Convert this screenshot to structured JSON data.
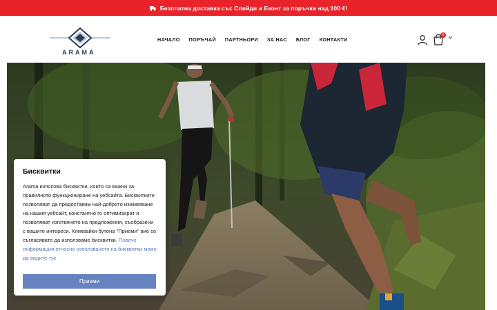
{
  "promo": {
    "text": "Безплатна доставка със Спийди и Еконт за поръчки над 100 €!",
    "icon": "truck-icon",
    "background": "#e8232a"
  },
  "header": {
    "logo_text": "ARAMA",
    "nav": [
      "НАЧАЛО",
      "ПОРЪЧАЙ",
      "ПАРТНЬОРИ",
      "ЗА НАС",
      "БЛОГ",
      "КОНТАКТИ"
    ],
    "cart_count": "0",
    "icons": [
      "user-icon",
      "cart-icon",
      "chevron-down-icon"
    ]
  },
  "cookie": {
    "title": "Бисквитки",
    "body": "Arama използва бисквитки, които са важни за правилното функциониране на уебсайта. Бисквитките позволяват да предоставим най-доброто изживяване на нашия уебсайт, константно го оптимизират и позволяват изготвянето на предложения, съобразени с вашите интереси. Кликвайки бутона \"Приеми\" вие се съгласявате да използваме бисквитки.",
    "link": "Повече информация относно използването на бисквитки може да видите тук",
    "accept_label": "Приеми",
    "accent": "#6782c0"
  }
}
